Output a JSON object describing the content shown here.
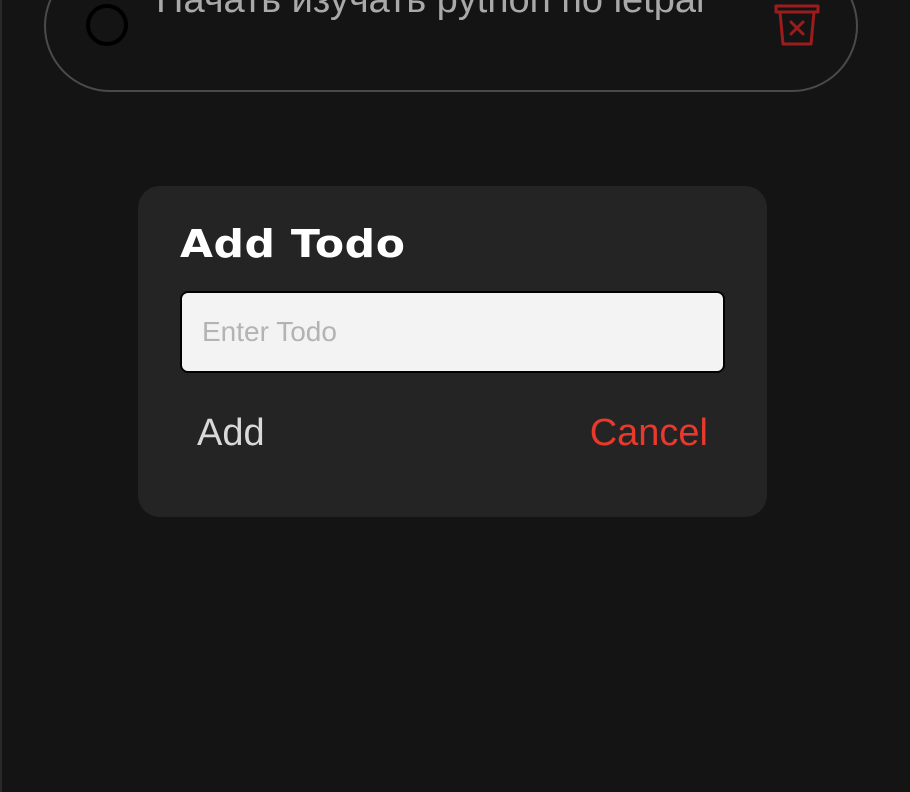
{
  "todo": {
    "text": "Начать изучать python по letpai",
    "delete_icon": "trash-x-icon",
    "check_icon": "circle-outline"
  },
  "dialog": {
    "title": "Add Todo",
    "input": {
      "value": "",
      "placeholder": "Enter Todo"
    },
    "add_label": "Add",
    "cancel_label": "Cancel"
  },
  "colors": {
    "background": "#141414",
    "dialog_bg": "#242424",
    "danger": "#e8392c",
    "delete_icon": "#9b1c1c"
  }
}
